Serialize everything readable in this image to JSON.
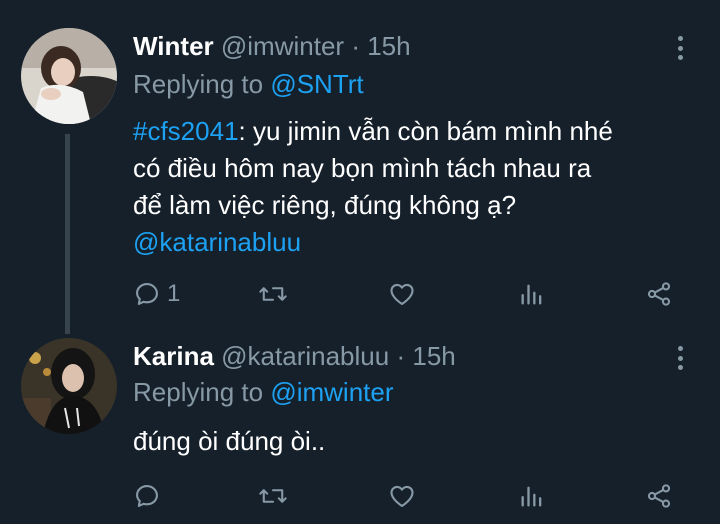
{
  "tweets": [
    {
      "name": "Winter",
      "handle": "@imwinter",
      "separator": "·",
      "time": "15h",
      "replying_prefix": "Replying to",
      "replying_to": "@SNTrt",
      "hashtag": "#cfs2041",
      "body_line1_rest": ": yu jimin vẫn còn bám mình nhé",
      "body_line2": "có điều hôm nay bọn mình tách nhau ra",
      "body_line3": "để làm việc riêng, đúng không ạ?",
      "mention": "@katarinabluu",
      "reply_count": "1",
      "icons": [
        "reply-icon",
        "retweet-icon",
        "like-icon",
        "stats-icon",
        "share-icon",
        "more-icon"
      ]
    },
    {
      "name": "Karina",
      "handle": "@katarinabluu",
      "separator": "·",
      "time": "15h",
      "replying_prefix": "Replying to",
      "replying_to": "@imwinter",
      "body_line1": "đúng òi đúng òi..",
      "icons": [
        "reply-icon",
        "retweet-icon",
        "like-icon",
        "stats-icon",
        "share-icon",
        "more-icon"
      ]
    }
  ],
  "colors": {
    "background": "#15202b",
    "text": "#ffffff",
    "muted": "#8899a6",
    "link": "#1da1f2",
    "thread_line": "#38444d"
  }
}
